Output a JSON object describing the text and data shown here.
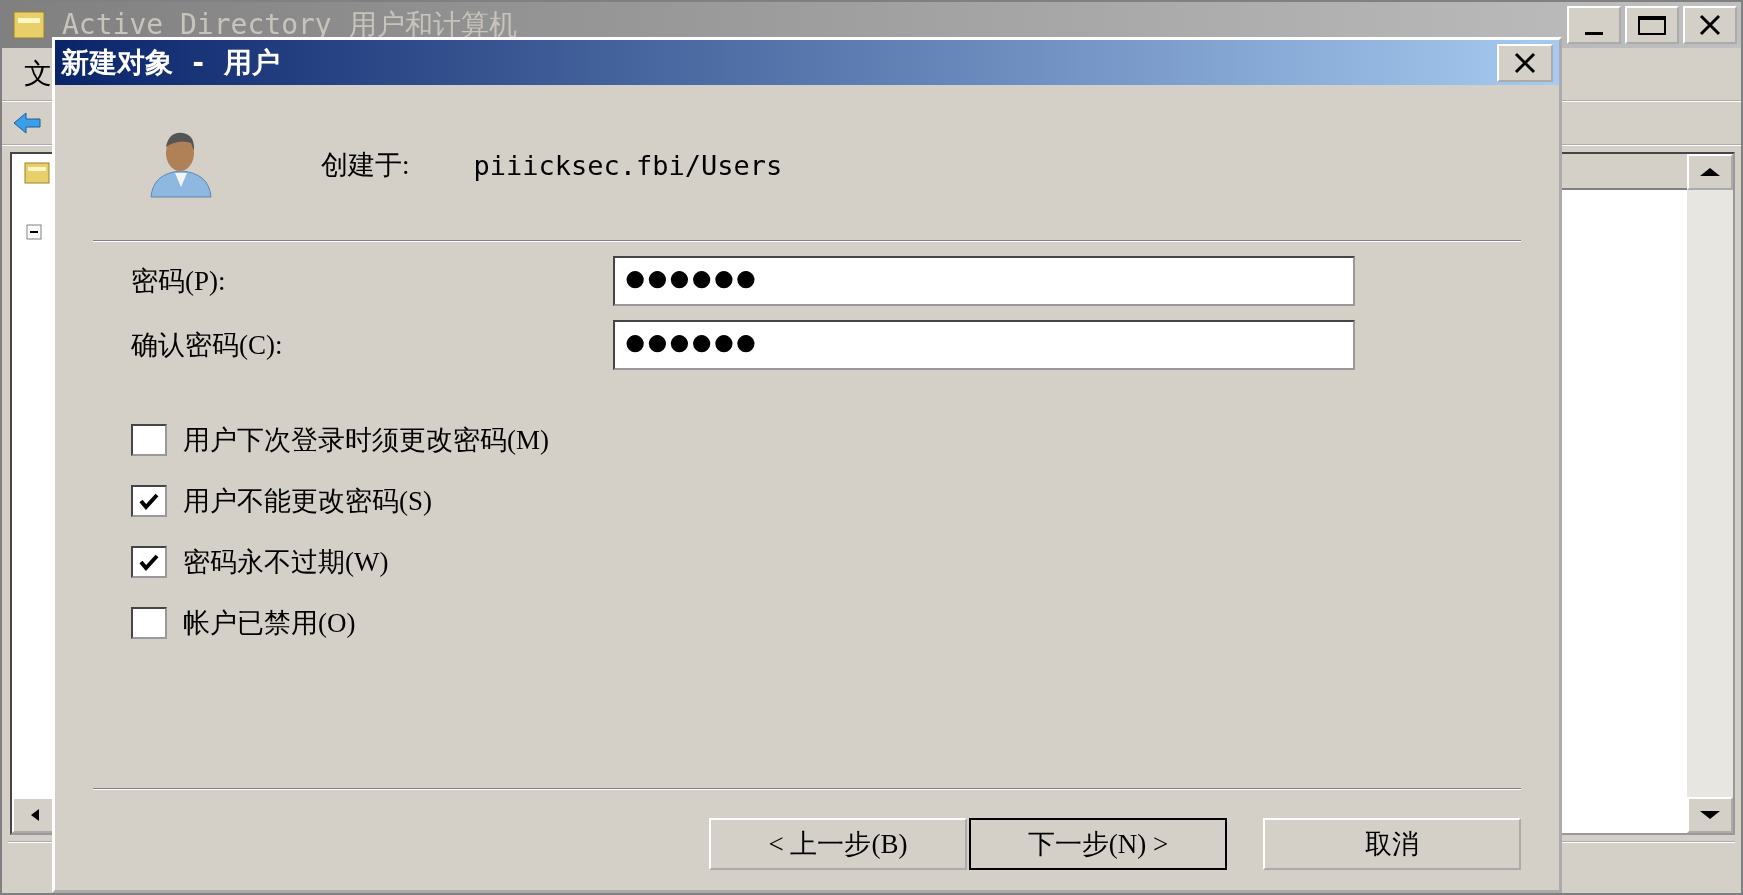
{
  "main_window": {
    "title": "Active Directory 用户和计算机",
    "menu": [
      "文"
    ]
  },
  "dialog": {
    "title": "新建对象 - 用户",
    "created_in_label": "创建于:",
    "created_in_value": "piiicksec.fbi/Users",
    "fields": [
      {
        "label": "密码(P):",
        "value": "●●●●●●"
      },
      {
        "label": "确认密码(C):",
        "value": "●●●●●●"
      }
    ],
    "options": [
      {
        "label": "用户下次登录时须更改密码(M)",
        "checked": false
      },
      {
        "label": "用户不能更改密码(S)",
        "checked": true
      },
      {
        "label": "密码永不过期(W)",
        "checked": true
      },
      {
        "label": "帐户已禁用(O)",
        "checked": false
      }
    ],
    "buttons": [
      {
        "label": "< 上一步(B)",
        "default": false
      },
      {
        "label": "下一步(N) >",
        "default": true
      },
      {
        "label": "取消",
        "default": false
      }
    ]
  }
}
